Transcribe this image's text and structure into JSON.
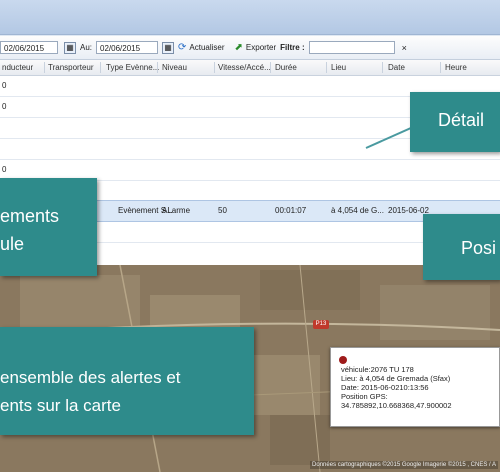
{
  "toolbar": {
    "date_from": "02/06/2015",
    "au_label": "Au:",
    "date_to": "02/06/2015",
    "refresh_label": "Actualiser",
    "export_label": "Exporter",
    "filter_label": "Filtre :",
    "filter_value": "",
    "clear_symbol": "×"
  },
  "grid": {
    "columns": [
      "nducteur",
      "Transporteur",
      "Type Evènne...",
      "Niveau",
      "Vitesse/Accé...",
      "Durée",
      "Lieu",
      "Date",
      "Heure"
    ],
    "rows": [
      {
        "c0": "0",
        "sel": false
      },
      {
        "c0": "0",
        "sel": false
      },
      {
        "c0": "",
        "sel": false
      },
      {
        "c0": "",
        "sel": false
      },
      {
        "c0": "0",
        "sel": false
      },
      {
        "c0": "",
        "sel": false
      },
      {
        "c0": "",
        "sel": false
      }
    ],
    "selected_row": {
      "type": "Evènement S...",
      "niveau": "ALarme",
      "vitesse": "50",
      "duree": "00:01:07",
      "lieu": "à 4,054 de G...",
      "date": "2015-06-02"
    }
  },
  "callouts": {
    "detail": "Détail",
    "events_line1": "ements",
    "events_line2": "ule",
    "position": "Posi",
    "map_line1": "ensemble  des alertes et",
    "map_line2": "ents sur la carte"
  },
  "map": {
    "road_label": "P13",
    "attribution": "Données cartographiques ©2015 Google Imagerie ©2015 , CNES / A",
    "info": {
      "vehicule": "véhicule:2076 TU 178",
      "lieu": "Lieu: à 4,054 de Gremada (Sfax)",
      "date": "Date: 2015-06-0210:13:56",
      "gps_label": "Position GPS:",
      "gps_value": "34.785892,10.668368,47.900002"
    }
  },
  "colors": {
    "callout": "#2e8b8b",
    "selected_row": "#dbe8f7"
  }
}
